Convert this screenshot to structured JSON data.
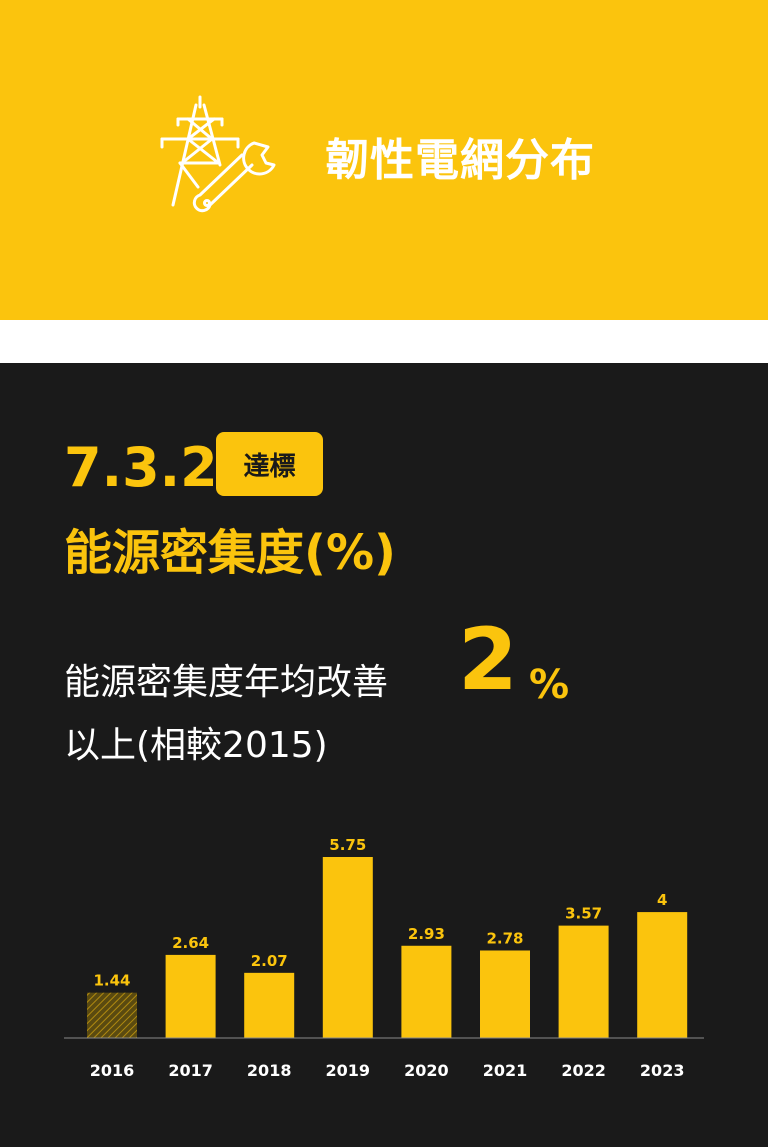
{
  "banner": {
    "title": "韌性電網分布",
    "icon": "power-tower-wrench-icon",
    "bg_color": "#fbc40d"
  },
  "goal": {
    "number": "7.3.2",
    "badge": "達標",
    "indicator": "能源密集度(%)",
    "desc_prefix": "能源密集度年均改善",
    "target_value": "2",
    "target_unit": "%",
    "desc_suffix": "以上(相較2015)"
  },
  "chart_data": {
    "type": "bar",
    "categories": [
      "2016",
      "2017",
      "2018",
      "2019",
      "2020",
      "2021",
      "2022",
      "2023"
    ],
    "values": [
      1.44,
      2.64,
      2.07,
      5.75,
      2.93,
      2.78,
      3.57,
      4
    ],
    "value_labels": [
      "1.44",
      "2.64",
      "2.07",
      "5.75",
      "2.93",
      "2.78",
      "3.57",
      "4"
    ],
    "ylim": [
      0,
      5.75
    ],
    "grid": false,
    "bar_color": "#fbc40d",
    "hatched_categories": [
      "2016"
    ],
    "title": "",
    "xlabel": "",
    "ylabel": ""
  }
}
